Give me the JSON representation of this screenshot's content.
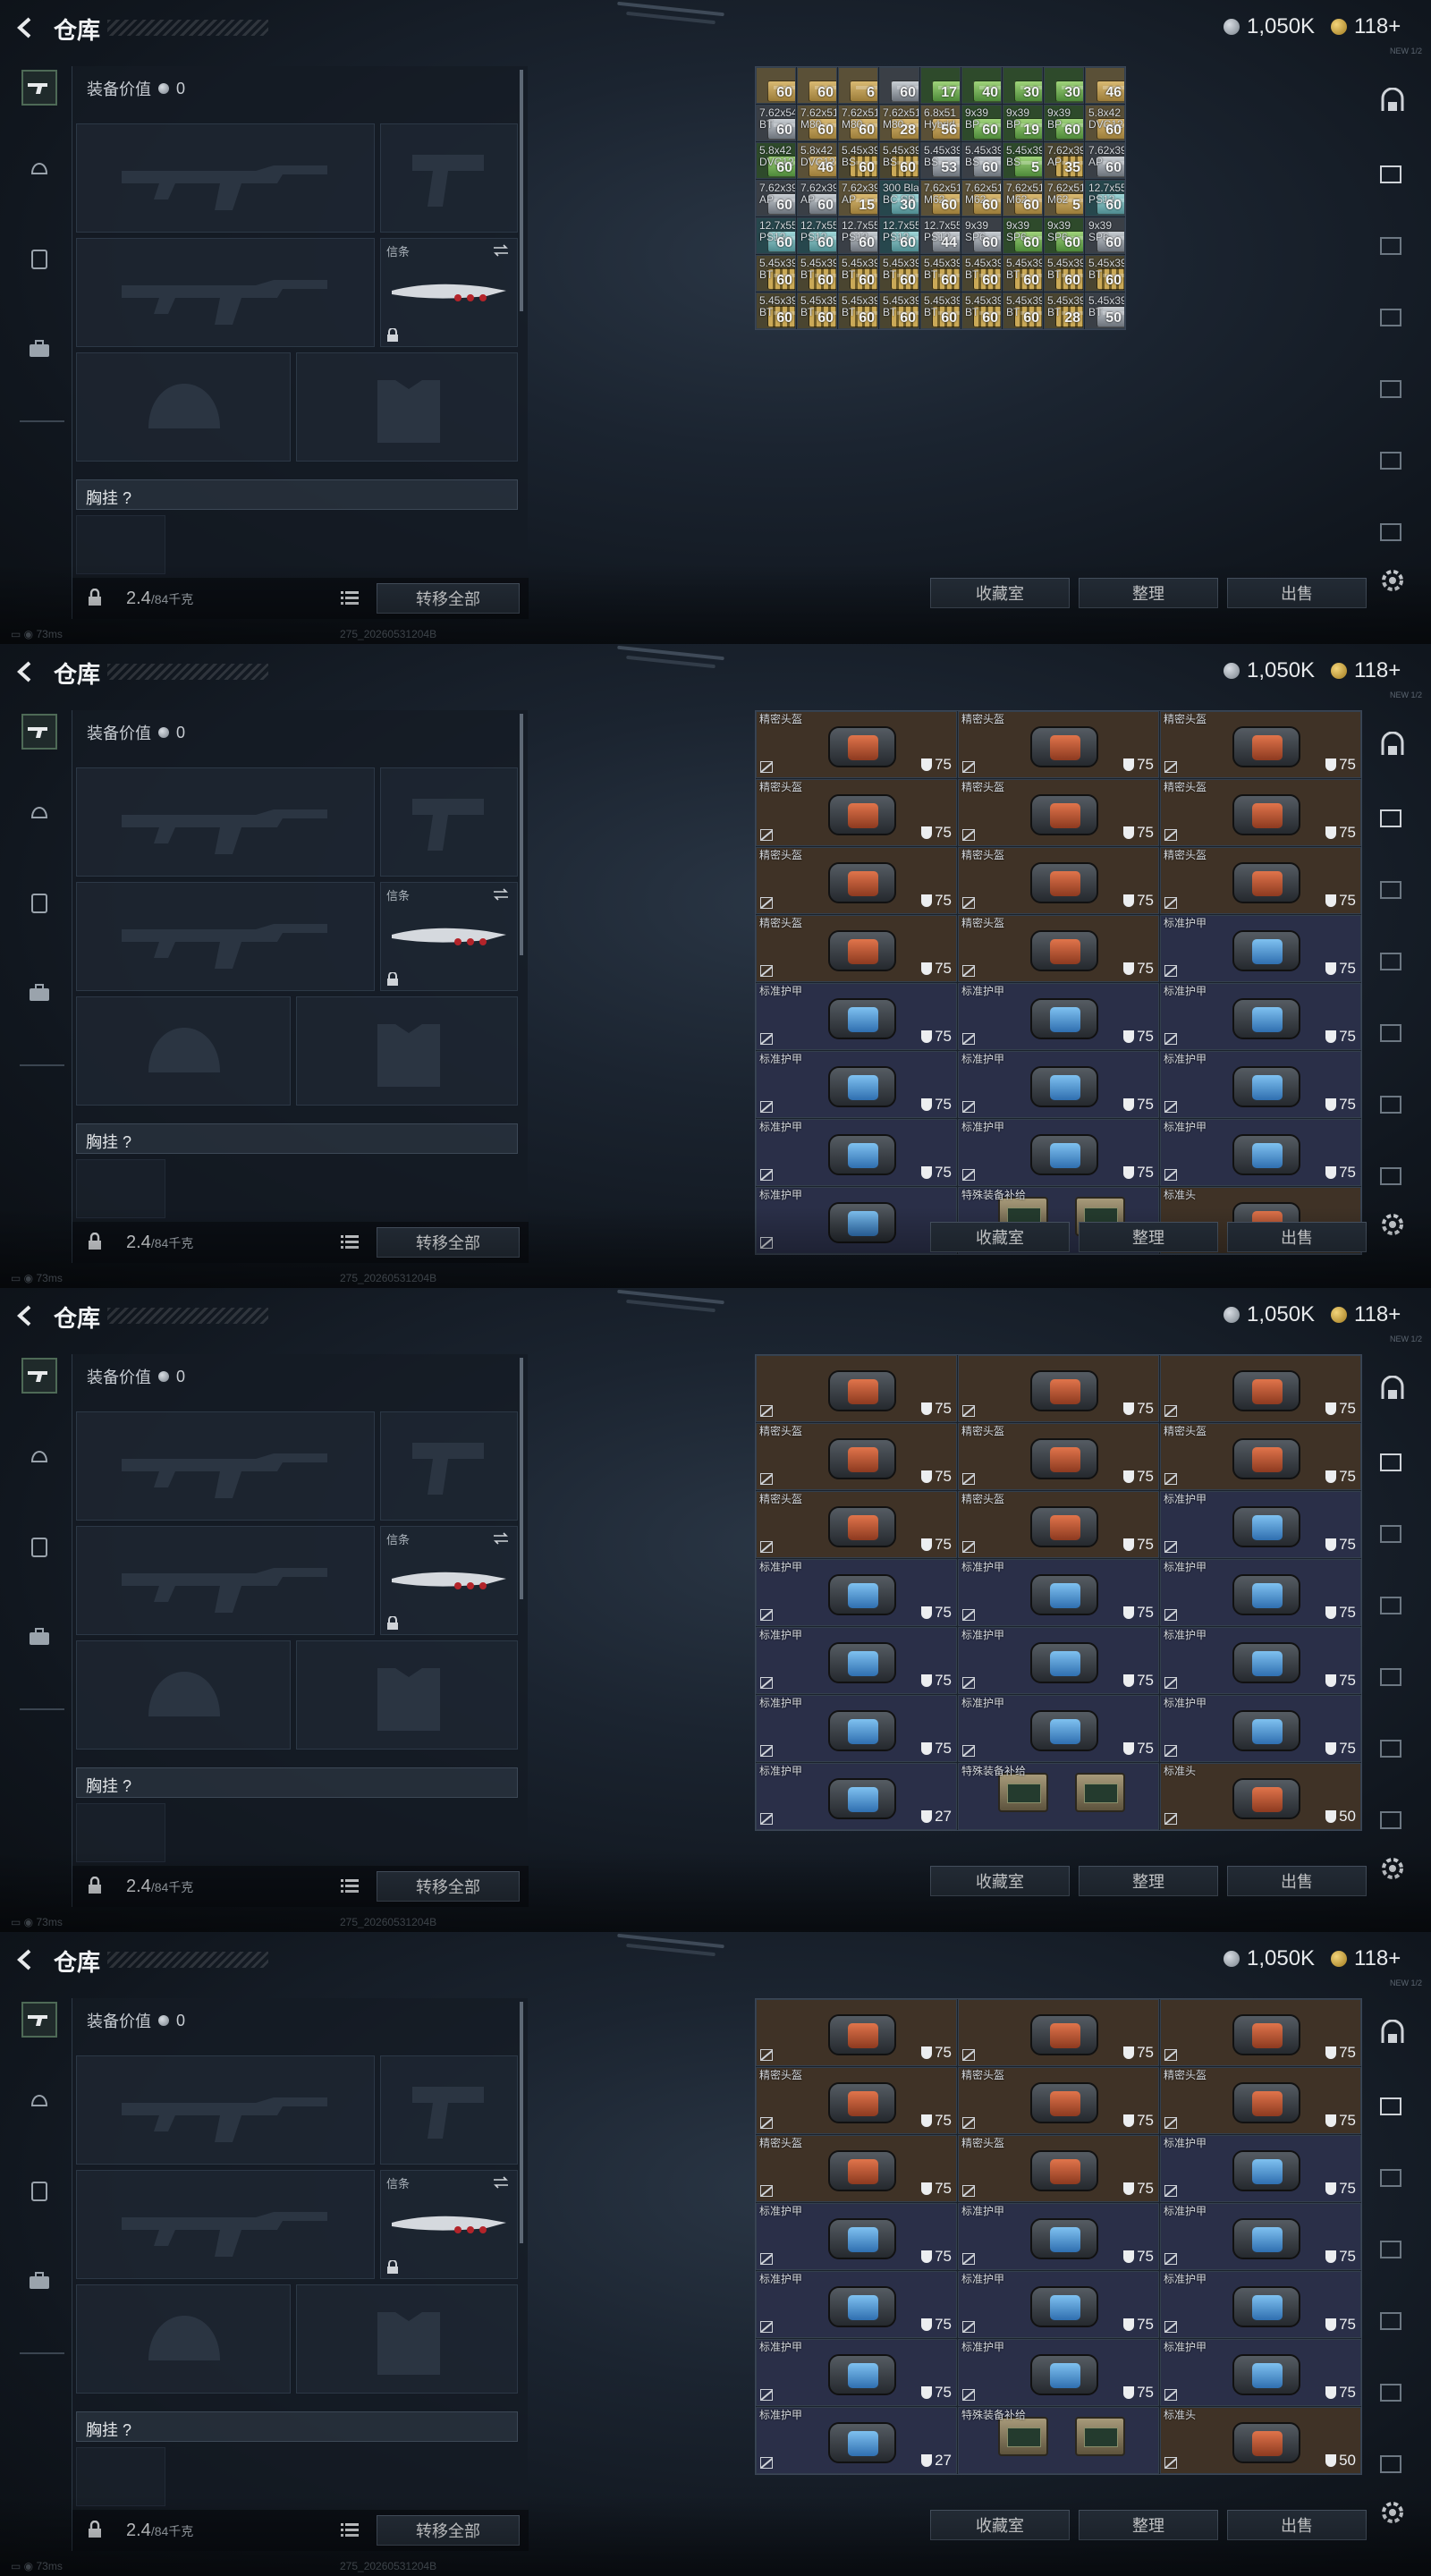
{
  "header": {
    "title": "仓库",
    "silver": "1,050K",
    "gold": "118+",
    "badge": "NEW 1/2"
  },
  "equipment": {
    "label": "装备价值",
    "value": "0",
    "melee_label": "信条",
    "vest_label": "胸挂",
    "help": "?",
    "weight": "2.4",
    "weight_cap": "/84千克",
    "transfer_all": "转移全部"
  },
  "stash": {
    "collection": "收藏室",
    "organize": "整理",
    "sell": "出售"
  },
  "status": {
    "ping": "73ms",
    "build": "275_20260531204B"
  },
  "colors": {
    "accent": "#4e6a56",
    "panel": "#141b24",
    "button": "#262f3a"
  },
  "icons": [
    "back-icon",
    "rifle-icon",
    "helmet-icon",
    "armor-icon",
    "backpack-icon",
    "lock-icon",
    "list-icon",
    "settings-icon",
    "shield-icon",
    "no-repair-icon"
  ],
  "panels": [
    {
      "cols": 9,
      "rows": 7,
      "cell": [
        45,
        41
      ],
      "cells": [
        {
          "t": "tan",
          "n": "",
          "q": "60"
        },
        {
          "t": "tan",
          "n": "",
          "q": "60"
        },
        {
          "t": "tan",
          "n": "",
          "q": "6"
        },
        {
          "t": "gry",
          "n": "",
          "q": "60"
        },
        {
          "t": "grn",
          "n": "",
          "q": "17"
        },
        {
          "t": "grn",
          "n": "",
          "q": "40"
        },
        {
          "t": "grn",
          "n": "",
          "q": "30"
        },
        {
          "t": "grn",
          "n": "",
          "q": "30"
        },
        {
          "t": "tan",
          "n": "",
          "q": "46"
        },
        {
          "t": "gry",
          "n": "7.62x54R\nBT",
          "q": "60"
        },
        {
          "t": "tan",
          "n": "7.62x51\nM80",
          "q": "60"
        },
        {
          "t": "tan",
          "n": "7.62x51\nM80",
          "q": "60"
        },
        {
          "t": "tan",
          "n": "7.62x51\nM80",
          "q": "28"
        },
        {
          "t": "tan",
          "n": "6.8x51\nHybrid",
          "q": "56"
        },
        {
          "t": "grn",
          "n": "9x39\nBP",
          "q": "60"
        },
        {
          "t": "grn",
          "n": "9x39\nBP",
          "q": "19"
        },
        {
          "t": "grn",
          "n": "9x39\nBP",
          "q": "60"
        },
        {
          "t": "tan",
          "n": "5.8x42\nDVC12",
          "q": "60"
        },
        {
          "t": "grn",
          "n": "5.8x42\nDVC12",
          "q": "60"
        },
        {
          "t": "tan",
          "n": "5.8x42\nDVC12",
          "q": "46"
        },
        {
          "t": "brass",
          "n": "5.45x39\nBS",
          "q": "60"
        },
        {
          "t": "brass",
          "n": "5.45x39\nBS",
          "q": "60"
        },
        {
          "t": "gry",
          "n": "5.45x39\nBS",
          "q": "53"
        },
        {
          "t": "gry",
          "n": "5.45x39\nBS",
          "q": "60"
        },
        {
          "t": "grn",
          "n": "5.45x39\nBS",
          "q": "5"
        },
        {
          "t": "brass",
          "n": "7.62x39\nAP",
          "q": "35"
        },
        {
          "t": "gry",
          "n": "7.62x39\nAP",
          "q": "60"
        },
        {
          "t": "gry",
          "n": "7.62x39\nAP",
          "q": "60"
        },
        {
          "t": "gry",
          "n": "7.62x39\nAP",
          "q": "60"
        },
        {
          "t": "tan",
          "n": "7.62x39\nAP",
          "q": "15"
        },
        {
          "t": "teal",
          "n": "300 Bla\nBC SB",
          "q": "30"
        },
        {
          "t": "tan",
          "n": "7.62x51\nM62",
          "q": "60"
        },
        {
          "t": "tan",
          "n": "7.62x51\nM62",
          "q": "60"
        },
        {
          "t": "tan",
          "n": "7.62x51\nM62",
          "q": "60"
        },
        {
          "t": "tan",
          "n": "7.62x51\nM62",
          "q": "5"
        },
        {
          "t": "teal",
          "n": "12.7x55\nPS12",
          "q": "60"
        },
        {
          "t": "teal",
          "n": "12.7x55\nPS12",
          "q": "60"
        },
        {
          "t": "teal",
          "n": "12.7x55\nPS12",
          "q": "60"
        },
        {
          "t": "gry",
          "n": "12.7x55\nPS12",
          "q": "60"
        },
        {
          "t": "teal",
          "n": "12.7x55\nPS12",
          "q": "60"
        },
        {
          "t": "gry",
          "n": "12.7x55\nPS12",
          "q": "44"
        },
        {
          "t": "gry",
          "n": "9x39\nSP6",
          "q": "60"
        },
        {
          "t": "grn",
          "n": "9x39\nSP6",
          "q": "60"
        },
        {
          "t": "grn",
          "n": "9x39\nSP6",
          "q": "60"
        },
        {
          "t": "gry",
          "n": "9x39\nSP6",
          "q": "60"
        },
        {
          "t": "brass",
          "n": "5.45x39\nBT",
          "q": "60"
        },
        {
          "t": "brass",
          "n": "5.45x39\nBT",
          "q": "60"
        },
        {
          "t": "brass",
          "n": "5.45x39\nBT",
          "q": "60"
        },
        {
          "t": "brass",
          "n": "5.45x39\nBT",
          "q": "60"
        },
        {
          "t": "brass",
          "n": "5.45x39\nBT",
          "q": "60"
        },
        {
          "t": "brass",
          "n": "5.45x39\nBT",
          "q": "60"
        },
        {
          "t": "brass",
          "n": "5.45x39\nBT",
          "q": "60"
        },
        {
          "t": "brass",
          "n": "5.45x39\nBT",
          "q": "60"
        },
        {
          "t": "brass",
          "n": "5.45x39\nBT",
          "q": "60"
        },
        {
          "t": "brass",
          "n": "5.45x39\nBT",
          "q": "60"
        },
        {
          "t": "brass",
          "n": "5.45x39\nBT",
          "q": "60"
        },
        {
          "t": "brass",
          "n": "5.45x39\nBT",
          "q": "60"
        },
        {
          "t": "brass",
          "n": "5.45x39\nBT",
          "q": "60"
        },
        {
          "t": "brass",
          "n": "5.45x39\nBT",
          "q": "60"
        },
        {
          "t": "brass",
          "n": "5.45x39\nBT",
          "q": "60"
        },
        {
          "t": "brass",
          "n": "5.45x39\nBT",
          "q": "60"
        },
        {
          "t": "brass",
          "n": "5.45x39\nBT",
          "q": "28"
        },
        {
          "t": "gry",
          "n": "5.45x39\nBT",
          "q": "50"
        }
      ]
    },
    {
      "cols": 3,
      "rows": 8,
      "cell": [
        225,
        75
      ],
      "cells": [
        {
          "t": "brw",
          "n": "精密头盔",
          "d": "75"
        },
        {
          "t": "brw",
          "n": "精密头盔",
          "d": "75"
        },
        {
          "t": "brw",
          "n": "精密头盔",
          "d": "75"
        },
        {
          "t": "brw",
          "n": "精密头盔",
          "d": "75"
        },
        {
          "t": "brw",
          "n": "精密头盔",
          "d": "75"
        },
        {
          "t": "brw",
          "n": "精密头盔",
          "d": "75"
        },
        {
          "t": "brw",
          "n": "精密头盔",
          "d": "75"
        },
        {
          "t": "brw",
          "n": "精密头盔",
          "d": "75"
        },
        {
          "t": "brw",
          "n": "精密头盔",
          "d": "75"
        },
        {
          "t": "brw",
          "n": "精密头盔",
          "d": "75"
        },
        {
          "t": "brw",
          "n": "精密头盔",
          "d": "75"
        },
        {
          "t": "blu",
          "n": "标准护甲",
          "d": "75"
        },
        {
          "t": "blu",
          "n": "标准护甲",
          "d": "75"
        },
        {
          "t": "blu",
          "n": "标准护甲",
          "d": "75"
        },
        {
          "t": "blu",
          "n": "标准护甲",
          "d": "75"
        },
        {
          "t": "blu",
          "n": "标准护甲",
          "d": "75"
        },
        {
          "t": "blu",
          "n": "标准护甲",
          "d": "75"
        },
        {
          "t": "blu",
          "n": "标准护甲",
          "d": "75"
        },
        {
          "t": "blu",
          "n": "标准护甲",
          "d": "75"
        },
        {
          "t": "blu",
          "n": "标准护甲",
          "d": "75"
        },
        {
          "t": "blu",
          "n": "标准护甲",
          "d": "75"
        },
        {
          "t": "blu",
          "n": "标准护甲",
          "d": ""
        },
        {
          "t": "case",
          "n": "特殊装备补给",
          "d": ""
        },
        {
          "t": "brw",
          "n": "标准头",
          "d": ""
        }
      ]
    },
    {
      "cols": 3,
      "rows": 7,
      "cell": [
        225,
        75
      ],
      "cells": [
        {
          "t": "brw",
          "n": "",
          "d": "75"
        },
        {
          "t": "brw",
          "n": "",
          "d": "75"
        },
        {
          "t": "brw",
          "n": "",
          "d": "75"
        },
        {
          "t": "brw",
          "n": "精密头盔",
          "d": "75"
        },
        {
          "t": "brw",
          "n": "精密头盔",
          "d": "75"
        },
        {
          "t": "brw",
          "n": "精密头盔",
          "d": "75"
        },
        {
          "t": "brw",
          "n": "精密头盔",
          "d": "75"
        },
        {
          "t": "brw",
          "n": "精密头盔",
          "d": "75"
        },
        {
          "t": "blu",
          "n": "标准护甲",
          "d": "75"
        },
        {
          "t": "blu",
          "n": "标准护甲",
          "d": "75"
        },
        {
          "t": "blu",
          "n": "标准护甲",
          "d": "75"
        },
        {
          "t": "blu",
          "n": "标准护甲",
          "d": "75"
        },
        {
          "t": "blu",
          "n": "标准护甲",
          "d": "75"
        },
        {
          "t": "blu",
          "n": "标准护甲",
          "d": "75"
        },
        {
          "t": "blu",
          "n": "标准护甲",
          "d": "75"
        },
        {
          "t": "blu",
          "n": "标准护甲",
          "d": "75"
        },
        {
          "t": "blu",
          "n": "标准护甲",
          "d": "75"
        },
        {
          "t": "blu",
          "n": "标准护甲",
          "d": "75"
        },
        {
          "t": "blu",
          "n": "标准护甲",
          "d": "27"
        },
        {
          "t": "case2",
          "n": "特殊装备补给",
          "d": ""
        },
        {
          "t": "brw",
          "n": "标准头",
          "d": "50"
        }
      ]
    },
    {
      "cols": 3,
      "rows": 7,
      "cell": [
        225,
        75
      ],
      "cells": [
        {
          "t": "brw",
          "n": "",
          "d": "75"
        },
        {
          "t": "brw",
          "n": "",
          "d": "75"
        },
        {
          "t": "brw",
          "n": "",
          "d": "75"
        },
        {
          "t": "brw",
          "n": "精密头盔",
          "d": "75"
        },
        {
          "t": "brw",
          "n": "精密头盔",
          "d": "75"
        },
        {
          "t": "brw",
          "n": "精密头盔",
          "d": "75"
        },
        {
          "t": "brw",
          "n": "精密头盔",
          "d": "75"
        },
        {
          "t": "brw",
          "n": "精密头盔",
          "d": "75"
        },
        {
          "t": "blu",
          "n": "标准护甲",
          "d": "75"
        },
        {
          "t": "blu",
          "n": "标准护甲",
          "d": "75"
        },
        {
          "t": "blu",
          "n": "标准护甲",
          "d": "75"
        },
        {
          "t": "blu",
          "n": "标准护甲",
          "d": "75"
        },
        {
          "t": "blu",
          "n": "标准护甲",
          "d": "75"
        },
        {
          "t": "blu",
          "n": "标准护甲",
          "d": "75"
        },
        {
          "t": "blu",
          "n": "标准护甲",
          "d": "75"
        },
        {
          "t": "blu",
          "n": "标准护甲",
          "d": "75"
        },
        {
          "t": "blu",
          "n": "标准护甲",
          "d": "75"
        },
        {
          "t": "blu",
          "n": "标准护甲",
          "d": "75"
        },
        {
          "t": "blu",
          "n": "标准护甲",
          "d": "27"
        },
        {
          "t": "case2",
          "n": "特殊装备补给",
          "d": ""
        },
        {
          "t": "brw",
          "n": "标准头",
          "d": "50"
        }
      ]
    }
  ]
}
